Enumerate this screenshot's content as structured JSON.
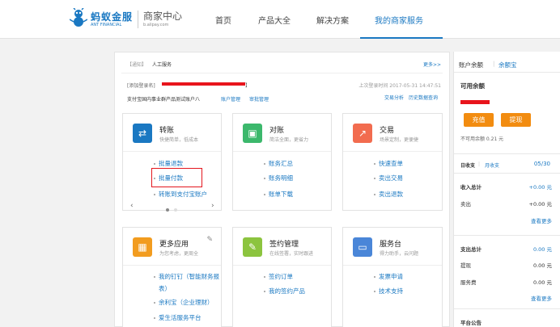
{
  "header": {
    "brand_cn": "蚂蚁金服",
    "brand_en": "ANT FINANCIAL",
    "center": "商家中心",
    "center_url": "b.alipay.com",
    "nav": [
      "首页",
      "产品大全",
      "解决方案",
      "我的商家服务"
    ]
  },
  "notice": {
    "tag": "【通知】",
    "text": "人工服务",
    "more": "更多>>"
  },
  "account": {
    "prefix": "[添加登录名]",
    "name_suffix": "】",
    "last_login": "上次登录时间 2017-05-31 14:47:51",
    "company": "支付宝国内事业群产品测试账户八",
    "manage": "账户管理",
    "audit": "审批管理",
    "analysis": "交易分析",
    "history": "历史数据查询"
  },
  "cards": [
    {
      "title": "转账",
      "sub": "快捷简单，低成本",
      "color": "#1a78c2",
      "icon": "⇄",
      "links": [
        "批量退款",
        "批量付款",
        "转账到支付宝账户"
      ],
      "pager": true
    },
    {
      "title": "对账",
      "sub": "简洁全面，更省力",
      "color": "#3cb86c",
      "icon": "▣",
      "links": [
        "账务汇总",
        "账务明细",
        "账单下载"
      ]
    },
    {
      "title": "交易",
      "sub": "场景定制，更便捷",
      "color": "#f26c4f",
      "icon": "↗",
      "links": [
        "快速查单",
        "卖出交易",
        "卖出退款"
      ]
    },
    {
      "title": "更多应用",
      "sub": "为您考虑，更周全",
      "color": "#f29c1f",
      "icon": "▦",
      "links": [
        "我的钉钉（智能财务报",
        "表）",
        "余利宝（企业理财）",
        "爱生活服务平台"
      ]
    },
    {
      "title": "签约管理",
      "sub": "在线签署，实时跟进",
      "color": "#8cc43f",
      "icon": "✎",
      "links": [
        "签约订单",
        "我的签约产品"
      ]
    },
    {
      "title": "服务台",
      "sub": "得力助手，云问题",
      "color": "#4a86d8",
      "icon": "▭",
      "links": [
        "发票申请",
        "技术支持"
      ]
    }
  ],
  "right": {
    "tab1": "账户余额",
    "tab2": "余额宝",
    "available": "可用余额",
    "charge": "充值",
    "withdraw": "提现",
    "unavailable": "不可用余额 0.21 元",
    "tab_a": "日收支",
    "tab_b": "月收支",
    "date": "05/30",
    "income_total": "收入总计",
    "income_total_val": "+0.00 元",
    "sell": "卖出",
    "sell_val": "+0.00 元",
    "more1": "查看更多",
    "expense_total": "支出总计",
    "expense_total_val": "0.00 元",
    "withdraw2": "提现",
    "withdraw2_val": "0.00 元",
    "fee": "服务费",
    "fee_val": "0.00 元",
    "more2": "查看更多",
    "notice": "平台公告"
  }
}
